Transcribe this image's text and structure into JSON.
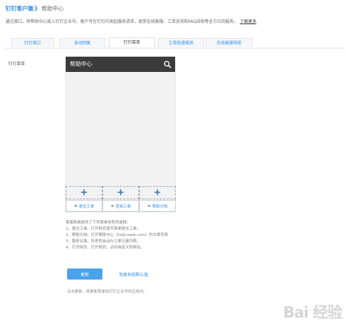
{
  "breadcrumb": {
    "parent": "钉钉客户端",
    "separator": "》",
    "current": "帮助中心"
  },
  "description": {
    "text": "通过接口，将帮助中心接入钉钉企业号。客户可在钉钉内发起服务请求，接受在线客服、工单支持和FAQ自助等全方位的服务。",
    "link": "了解更多"
  },
  "tabs": [
    {
      "label": "钉钉接口",
      "active": false
    },
    {
      "label": "自动回复",
      "active": false
    },
    {
      "label": "钉钉菜单",
      "active": true
    },
    {
      "label": "工单投递规则",
      "active": false
    },
    {
      "label": "在线客服导航",
      "active": false
    }
  ],
  "section_label": "钉钉菜单",
  "phone": {
    "title": "帮助中心",
    "search_icon": "search-icon",
    "add_symbol": "+",
    "menu_items": [
      {
        "label": "提交工单",
        "icon": "≡"
      },
      {
        "label": "查阅工单",
        "icon": "≡"
      },
      {
        "label": "帮助文档",
        "icon": "≡"
      }
    ]
  },
  "help": {
    "lines": [
      "客服系统提供了下列菜单类型供选择：",
      "1，提交工单。打开网页填写表单提交工单。",
      "2，帮助文档。打开帮助中心（help.ewei.com）的文章列表",
      "3，服务记录。历史的会话与工单记录列表。",
      "4，打开网页。打开网页，访问自定义的网址。"
    ]
  },
  "actions": {
    "update_label": "更新",
    "restore_label": "恢复系统默认值"
  },
  "note": "点击更新，将更新菜单到钉钉企业号的应用内。",
  "watermark": "Bai 经验",
  "colors": {
    "accent": "#2d8cf0",
    "header": "#3b3b3b",
    "button": "#4aa3ea"
  }
}
